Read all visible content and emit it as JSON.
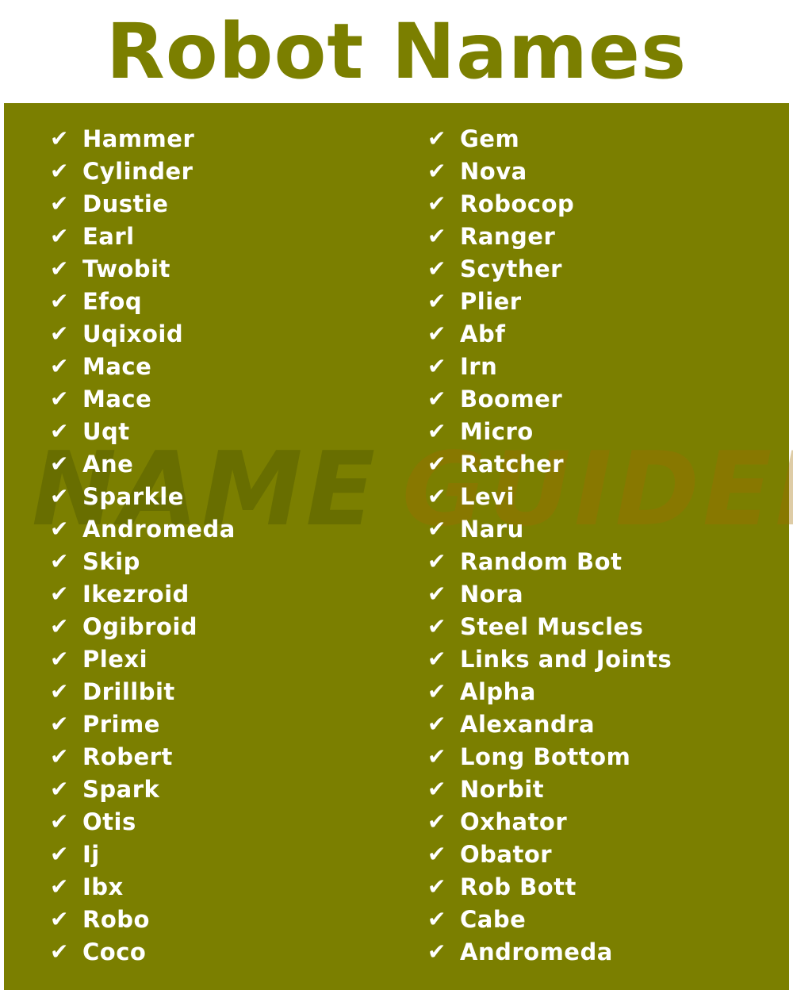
{
  "title": "Robot Names",
  "watermark": {
    "part1": "NAME",
    "part2": "GUIDER"
  },
  "icon": {
    "check": "✔"
  },
  "colors": {
    "accent": "#7b7f00",
    "text": "#ffffff",
    "background": "#ffffff"
  },
  "left_column": [
    "Hammer",
    "Cylinder",
    "Dustie",
    "Earl",
    "Twobit",
    "Efoq",
    "Uqixoid",
    "Mace",
    "Mace",
    "Uqt",
    "Ane",
    "Sparkle",
    "Andromeda",
    "Skip",
    "Ikezroid",
    "Ogibroid",
    "Plexi",
    "Drillbit",
    "Prime",
    "Robert",
    "Spark",
    "Otis",
    "Ij",
    "Ibx",
    "Robo",
    "Coco"
  ],
  "right_column": [
    "Gem",
    "Nova",
    "Robocop",
    "Ranger",
    "Scyther",
    "Plier",
    "Abf",
    "Irn",
    "Boomer",
    "Micro",
    "Ratcher",
    "Levi",
    "Naru",
    "Random Bot",
    "Nora",
    "Steel Muscles",
    "Links and Joints",
    "Alpha",
    "Alexandra",
    "Long Bottom",
    "Norbit",
    "Oxhator",
    "Obator",
    "Rob Bott",
    "Cabe",
    "Andromeda"
  ]
}
